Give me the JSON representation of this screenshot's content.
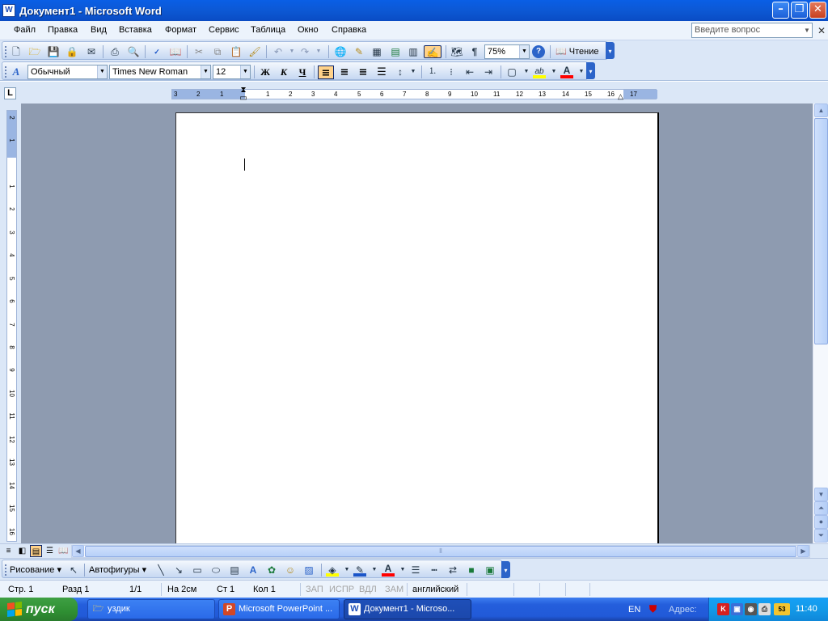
{
  "window": {
    "title": "Документ1 - Microsoft Word",
    "icon_label": "W",
    "minimize_icon": "minimize-icon",
    "maximize_icon": "restore-icon",
    "close_icon": "close-icon"
  },
  "menu": {
    "items": [
      "Файл",
      "Правка",
      "Вид",
      "Вставка",
      "Формат",
      "Сервис",
      "Таблица",
      "Окно",
      "Справка"
    ],
    "help_placeholder": "Введите вопрос"
  },
  "standard_toolbar": {
    "zoom": "75%",
    "reading_label": "Чтение",
    "pilcrow": "¶"
  },
  "formatting_toolbar": {
    "style": "Обычный",
    "font": "Times New Roman",
    "size": "12",
    "bold_label": "Ж",
    "italic_label": "К",
    "underline_label": "Ч",
    "style_icon_label": "A",
    "font_color_label": "A",
    "highlight_label": "ab",
    "highlight_color": "#ffff00",
    "font_color": "#ff0000"
  },
  "ruler": {
    "horizontal_ticks": [
      "3",
      "2",
      "1",
      "1",
      "2",
      "3",
      "4",
      "5",
      "6",
      "7",
      "8",
      "9",
      "10",
      "11",
      "12",
      "13",
      "14",
      "15",
      "16",
      "17"
    ],
    "vertical_ticks": [
      "2",
      "1",
      "1",
      "2",
      "3",
      "4",
      "5",
      "6",
      "7",
      "8",
      "9",
      "10",
      "11",
      "12",
      "13",
      "14",
      "15",
      "16"
    ],
    "tab_selector": "L"
  },
  "drawing_toolbar": {
    "draw_label": "Рисование",
    "autoshapes_label": "Автофигуры",
    "font_color_label": "A"
  },
  "status_bar": {
    "page": "Стр. 1",
    "section": "Разд 1",
    "pages": "1/1",
    "at": "На 2см",
    "line": "Ст 1",
    "col": "Кол 1",
    "rec": "ЗАП",
    "trk": "ИСПР",
    "ext": "ВДЛ",
    "ovr": "ЗАМ",
    "language": "английский"
  },
  "taskbar": {
    "start_label": "пуск",
    "tasks": [
      {
        "label": "уздик",
        "icon": "folder-icon"
      },
      {
        "label": "Microsoft PowerPoint ...",
        "icon": "powerpoint-icon"
      },
      {
        "label": "Документ1 - Microso...",
        "icon": "word-icon"
      }
    ],
    "lang": "EN",
    "address_label": "Адрес:",
    "clock": "11:40",
    "tray_badge": "53"
  },
  "colors": {
    "title_bar": "#0a5fe6",
    "toolbar_bg": "#dbe7f7",
    "workspace_bg": "#8e9bb0",
    "start_green": "#3ea043"
  }
}
